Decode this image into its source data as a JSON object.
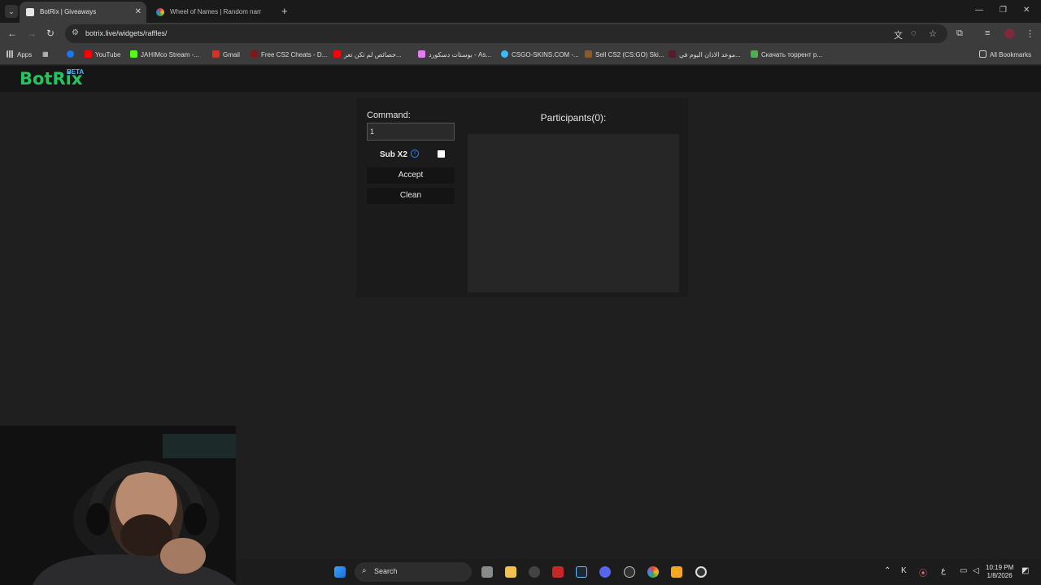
{
  "browser": {
    "tabs": [
      {
        "title": "BotRix | Giveaways",
        "active": true
      },
      {
        "title": "Wheel of Names | Random nam",
        "active": false
      }
    ],
    "url": "botrix.live/widgets/raffles/",
    "bookmarks": [
      {
        "label": "Apps"
      },
      {
        "label": "YouTube"
      },
      {
        "label": "JAHIMco Stream -..."
      },
      {
        "label": "Gmail"
      },
      {
        "label": "Free CS2 Cheats - D..."
      },
      {
        "label": "خصائص لم تكن تعر..."
      },
      {
        "label": "بوستات دسكورد - As..."
      },
      {
        "label": "CSGO-SKINS.COM -..."
      },
      {
        "label": "Sell CS2 (CS:GO) Ski..."
      },
      {
        "label": "موعد الاذان اليوم في..."
      },
      {
        "label": "Скачать торрент р..."
      }
    ],
    "all_bookmarks": "All Bookmarks"
  },
  "app": {
    "brand": "BotRix",
    "badge": "BETA",
    "command_label": "Command:",
    "command_value": "1",
    "sub_label": "Sub X2",
    "sub_checked": false,
    "accept_label": "Accept",
    "clean_label": "Clean",
    "participants_title": "Participants(0):"
  },
  "taskbar": {
    "search_label": "Search",
    "time": "10:19 PM",
    "date": "1/8/2026",
    "lang": "ع"
  },
  "colors": {
    "brand_green": "#22c55e",
    "beta_blue": "#4fb7ff",
    "info_blue": "#3b82f6"
  }
}
